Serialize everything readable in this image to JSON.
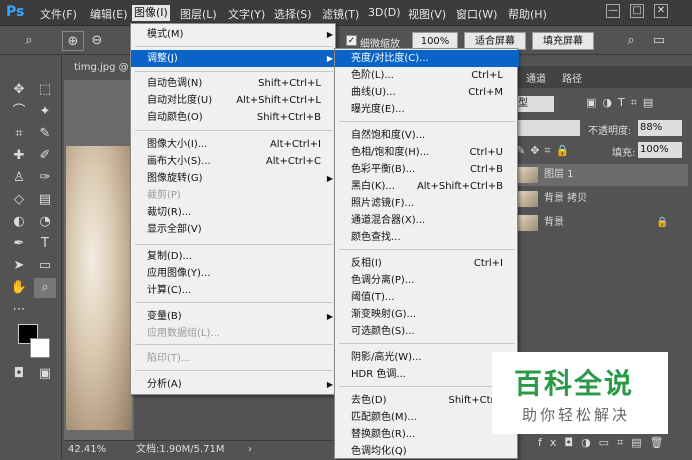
{
  "menubar": {
    "logo": "Ps",
    "items": [
      "文件(F)",
      "编辑(E)",
      "图像(I)",
      "图层(L)",
      "文字(Y)",
      "选择(S)",
      "滤镜(T)",
      "3D(D)",
      "视图(V)",
      "窗口(W)",
      "帮助(H)"
    ],
    "window_buttons": [
      "—",
      "□",
      "✕"
    ]
  },
  "options": {
    "checkbox_label": "细微缩放",
    "zoom_100": "100%",
    "fit_screen": "适合屏幕",
    "fill_screen": "填充屏幕"
  },
  "document": {
    "tab": "timg.jpg @",
    "zoom": "42.41%",
    "doc_size": "文档:1.90M/5.71M",
    "arrow": "›"
  },
  "image_menu": [
    {
      "label": "模式(M)",
      "shortcut": "",
      "submenu": true,
      "disabled": false
    },
    {
      "label": "调整(J)",
      "shortcut": "",
      "submenu": true,
      "disabled": false,
      "highlight": true
    },
    {
      "label": "自动色调(N)",
      "shortcut": "Shift+Ctrl+L",
      "disabled": false
    },
    {
      "label": "自动对比度(U)",
      "shortcut": "Alt+Shift+Ctrl+L",
      "disabled": false
    },
    {
      "label": "自动颜色(O)",
      "shortcut": "Shift+Ctrl+B",
      "disabled": false
    },
    {
      "label": "图像大小(I)...",
      "shortcut": "Alt+Ctrl+I",
      "disabled": false
    },
    {
      "label": "画布大小(S)...",
      "shortcut": "Alt+Ctrl+C",
      "disabled": false
    },
    {
      "label": "图像旋转(G)",
      "shortcut": "",
      "submenu": true,
      "disabled": false
    },
    {
      "label": "裁剪(P)",
      "shortcut": "",
      "disabled": true
    },
    {
      "label": "裁切(R)...",
      "shortcut": "",
      "disabled": false
    },
    {
      "label": "显示全部(V)",
      "shortcut": "",
      "disabled": false
    },
    {
      "label": "复制(D)...",
      "shortcut": "",
      "disabled": false
    },
    {
      "label": "应用图像(Y)...",
      "shortcut": "",
      "disabled": false
    },
    {
      "label": "计算(C)...",
      "shortcut": "",
      "disabled": false
    },
    {
      "label": "变量(B)",
      "shortcut": "",
      "submenu": true,
      "disabled": false
    },
    {
      "label": "应用数据组(L)...",
      "shortcut": "",
      "disabled": true
    },
    {
      "label": "陷印(T)...",
      "shortcut": "",
      "disabled": true
    },
    {
      "label": "分析(A)",
      "shortcut": "",
      "submenu": true,
      "disabled": false
    }
  ],
  "adjust_menu": [
    {
      "label": "亮度/对比度(C)...",
      "shortcut": "",
      "highlight": true
    },
    {
      "label": "色阶(L)...",
      "shortcut": "Ctrl+L"
    },
    {
      "label": "曲线(U)...",
      "shortcut": "Ctrl+M"
    },
    {
      "label": "曝光度(E)...",
      "shortcut": ""
    },
    {
      "label": "自然饱和度(V)...",
      "shortcut": ""
    },
    {
      "label": "色相/饱和度(H)...",
      "shortcut": "Ctrl+U"
    },
    {
      "label": "色彩平衡(B)...",
      "shortcut": "Ctrl+B"
    },
    {
      "label": "黑白(K)...",
      "shortcut": "Alt+Shift+Ctrl+B"
    },
    {
      "label": "照片滤镜(F)...",
      "shortcut": ""
    },
    {
      "label": "通道混合器(X)...",
      "shortcut": ""
    },
    {
      "label": "颜色查找...",
      "shortcut": ""
    },
    {
      "label": "反相(I)",
      "shortcut": "Ctrl+I"
    },
    {
      "label": "色调分离(P)...",
      "shortcut": ""
    },
    {
      "label": "阈值(T)...",
      "shortcut": ""
    },
    {
      "label": "渐变映射(G)...",
      "shortcut": ""
    },
    {
      "label": "可选颜色(S)...",
      "shortcut": ""
    },
    {
      "label": "阴影/高光(W)...",
      "shortcut": ""
    },
    {
      "label": "HDR 色调...",
      "shortcut": ""
    },
    {
      "label": "去色(D)",
      "shortcut": "Shift+Ctr+"
    },
    {
      "label": "匹配颜色(M)...",
      "shortcut": ""
    },
    {
      "label": "替换颜色(R)...",
      "shortcut": ""
    },
    {
      "label": "色调均化(Q)",
      "shortcut": ""
    }
  ],
  "panel": {
    "tabs": [
      "通道",
      "路径"
    ],
    "kind": "型",
    "opacity_label": "不透明度:",
    "opacity_value": "88%",
    "lock_label": "锁定:",
    "fill_label": "填充:",
    "fill_value": "100%",
    "layers": [
      "图层 1",
      "背景 拷贝",
      "背景"
    ]
  },
  "watermark": {
    "main": "百科全说",
    "sub": "助你轻松解决"
  }
}
